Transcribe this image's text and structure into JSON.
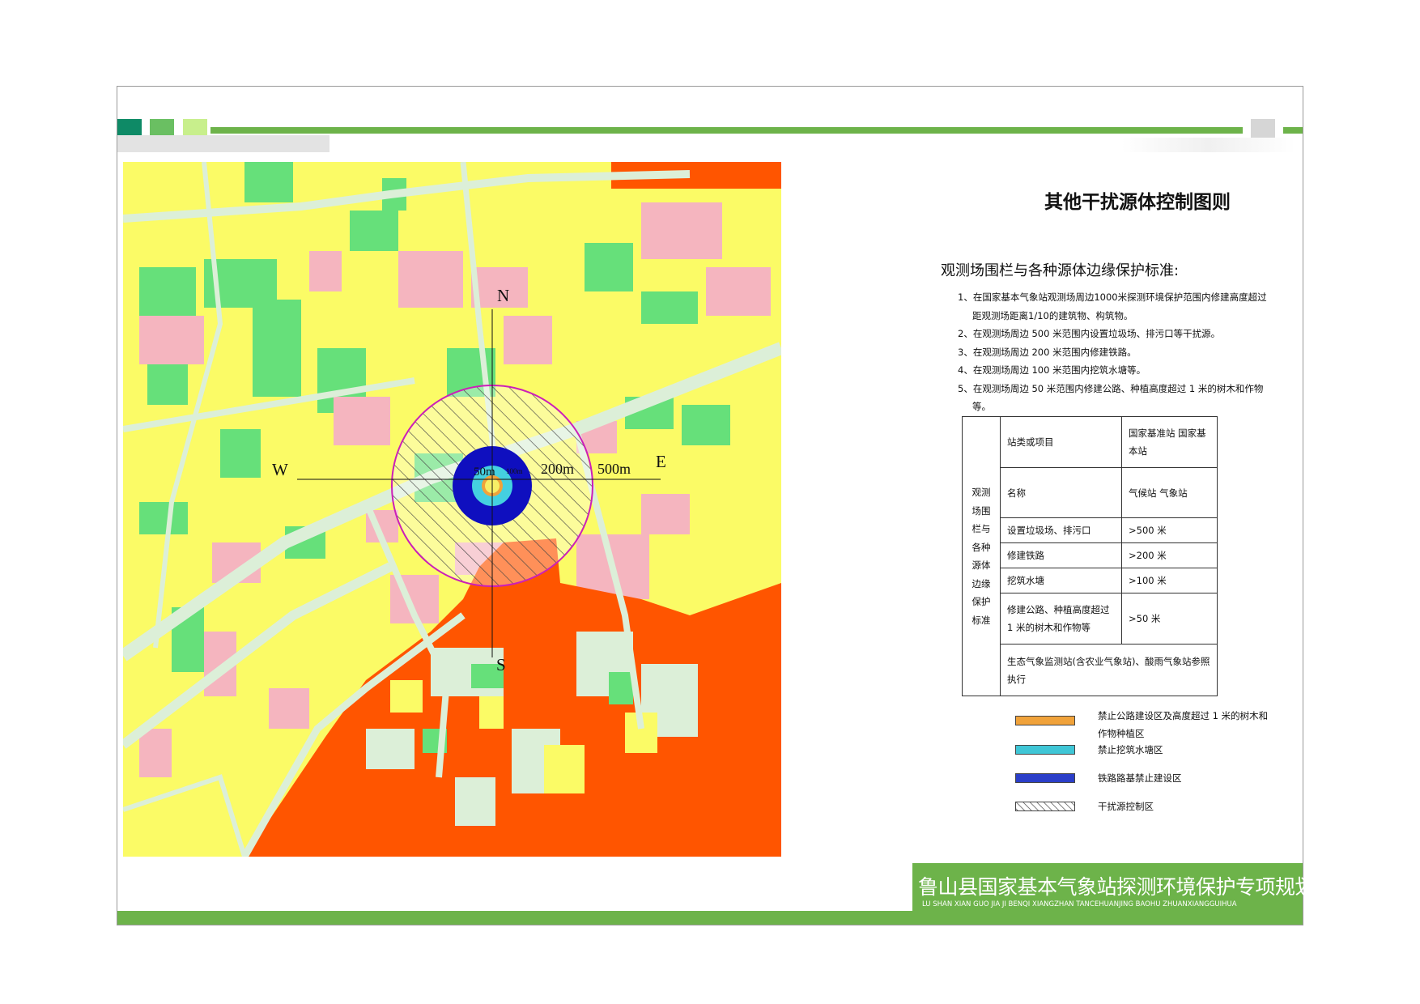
{
  "title": "其他干扰源体控制图则",
  "subtitle": "观测场围栏与各种源体边缘保护标准:",
  "rules": [
    "1、在国家基本气象站观测场周边1000米探测环境保护范围内修建高度超过距观测场距离1/10的建筑物、构筑物。",
    "2、在观测场周边 500 米范围内设置垃圾场、排污口等干扰源。",
    "3、在观测场周边 200 米范围内修建铁路。",
    "4、在观测场周边 100 米范围内挖筑水塘等。",
    "5、在观测场周边 50 米范围内修建公路、种植高度超过 1 米的树木和作物等。"
  ],
  "table": {
    "side_label": "观测场围栏与各种源体边缘保护标准",
    "rows": [
      {
        "item": "站类或项目",
        "value": "国家基准站 国家基本站"
      },
      {
        "item": "名称",
        "value": "气候站 气象站"
      },
      {
        "item": "设置垃圾场、排污口",
        "value": ">500 米"
      },
      {
        "item": "修建铁路",
        "value": ">200 米"
      },
      {
        "item": "挖筑水塘",
        "value": ">100 米"
      },
      {
        "item": "修建公路、种植高度超过 1 米的树木和作物等",
        "value": ">50 米"
      }
    ],
    "footer_note": "生态气象监测站(含农业气象站)、酸雨气象站参照执行"
  },
  "legend": [
    {
      "label": "禁止公路建设区及高度超过 1 米的树木和作物种植区",
      "color": "#f0a23a",
      "pattern": "solid"
    },
    {
      "label": "禁止挖筑水塘区",
      "color": "#3fc6d6",
      "pattern": "solid"
    },
    {
      "label": "铁路路基禁止建设区",
      "color": "#2b3ec8",
      "pattern": "solid"
    },
    {
      "label": "干扰源控制区",
      "color": "#333333",
      "pattern": "hatch"
    }
  ],
  "map": {
    "compass": {
      "north": "N",
      "south": "S",
      "east": "E",
      "west": "W"
    },
    "rings": [
      "50m",
      "100m",
      "200m",
      "500m"
    ],
    "colors": {
      "residential": "#fbfb66",
      "green": "#66e07a",
      "pink": "#f5b5bf",
      "industrial": "#ff5500",
      "road": "#dcefd8",
      "ring500": "#cc1fb8",
      "ring200": "#0f0fbf",
      "ring100": "#44d0e0",
      "ring50": "#f0a23a"
    }
  },
  "footer": {
    "title_cn": "鲁山县国家基本气象站探测环境保护专项规划",
    "title_en": "LU SHAN XIAN GUO JIA JI BENQI XIANGZHAN TANCEHUANJING BAOHU ZHUANXIANGGUIHUA"
  }
}
